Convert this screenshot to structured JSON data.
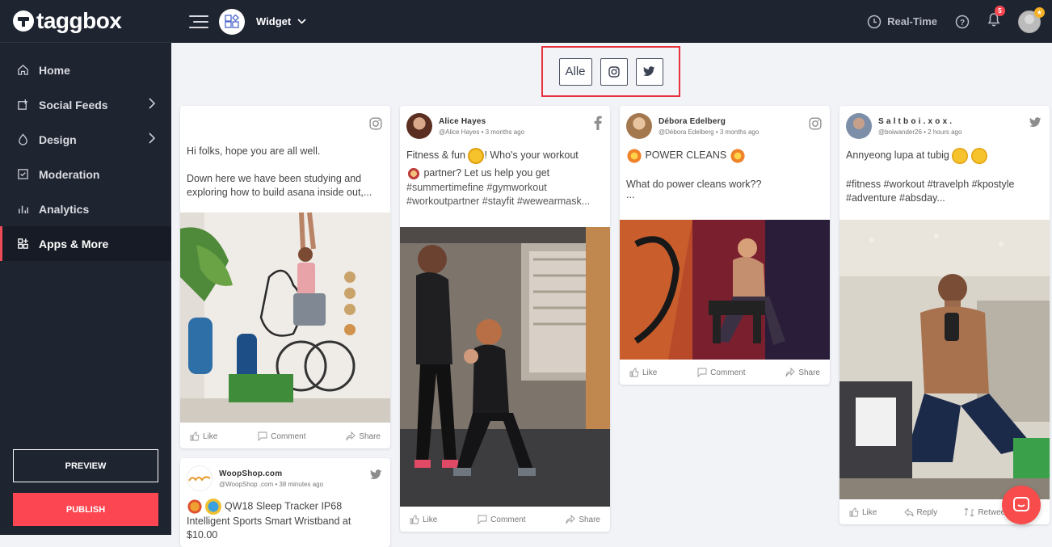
{
  "app": {
    "logo_text": "taggbox"
  },
  "sidebar": {
    "items": [
      {
        "label": "Home",
        "icon": "home-icon"
      },
      {
        "label": "Social Feeds",
        "icon": "social-feeds-icon"
      },
      {
        "label": "Design",
        "icon": "design-icon"
      },
      {
        "label": "Moderation",
        "icon": "moderation-icon"
      },
      {
        "label": "Analytics",
        "icon": "analytics-icon"
      },
      {
        "label": "Apps & More",
        "icon": "apps-icon",
        "active": true
      }
    ],
    "preview_label": "PREVIEW",
    "publish_label": "PUBLISH"
  },
  "topbar": {
    "widget_label": "Widget",
    "realtime_label": "Real-Time",
    "notification_count": "5"
  },
  "filters": {
    "all_label": "Alle",
    "instagram_icon": "instagram-icon",
    "twitter_icon": "twitter-icon"
  },
  "posts": [
    {
      "network": "instagram",
      "text1": "Hi folks, hope you are all well.",
      "text2": "Down here we have been studying and exploring how to build asana inside out,...",
      "actions": [
        "Like",
        "Comment",
        "Share"
      ]
    },
    {
      "network": "facebook",
      "name": "Alice Hayes",
      "meta": "@Alice Hayes • 3 months ago",
      "text1a": "Fitness & fun ",
      "text1b": "! Who's your workout",
      "text2": " partner? Let us help you get",
      "text3": "#summertimefine #gymworkout",
      "text4": "#workoutpartner #stayfit #wewearmask...",
      "actions": [
        "Like",
        "Comment",
        "Share"
      ]
    },
    {
      "network": "instagram",
      "name": "Débora Edelberg",
      "meta": "@Débora Edelberg • 3 months ago",
      "text1": " POWER CLEANS ",
      "text2": "What do power cleans work??",
      "text3": "...",
      "actions": [
        "Like",
        "Comment",
        "Share"
      ]
    },
    {
      "network": "twitter",
      "name": "S a l t b o i . x o x .",
      "meta": "@boiwander26 • 2 hours ago",
      "text1": "Annyeong lupa at tubig ",
      "text2": "#fitness #workout #travelph #kpostyle",
      "text3": "#adventure #absday...",
      "actions": [
        "Like",
        "Reply",
        "Retweet"
      ]
    },
    {
      "network": "twitter",
      "name": "WoopShop.com",
      "meta": "@WoopShop .com • 38 minutes ago",
      "text1": " QW18 Sleep Tracker IP68",
      "text2": "Intelligent Sports Smart Wristband at",
      "text3": "$10.00"
    }
  ]
}
